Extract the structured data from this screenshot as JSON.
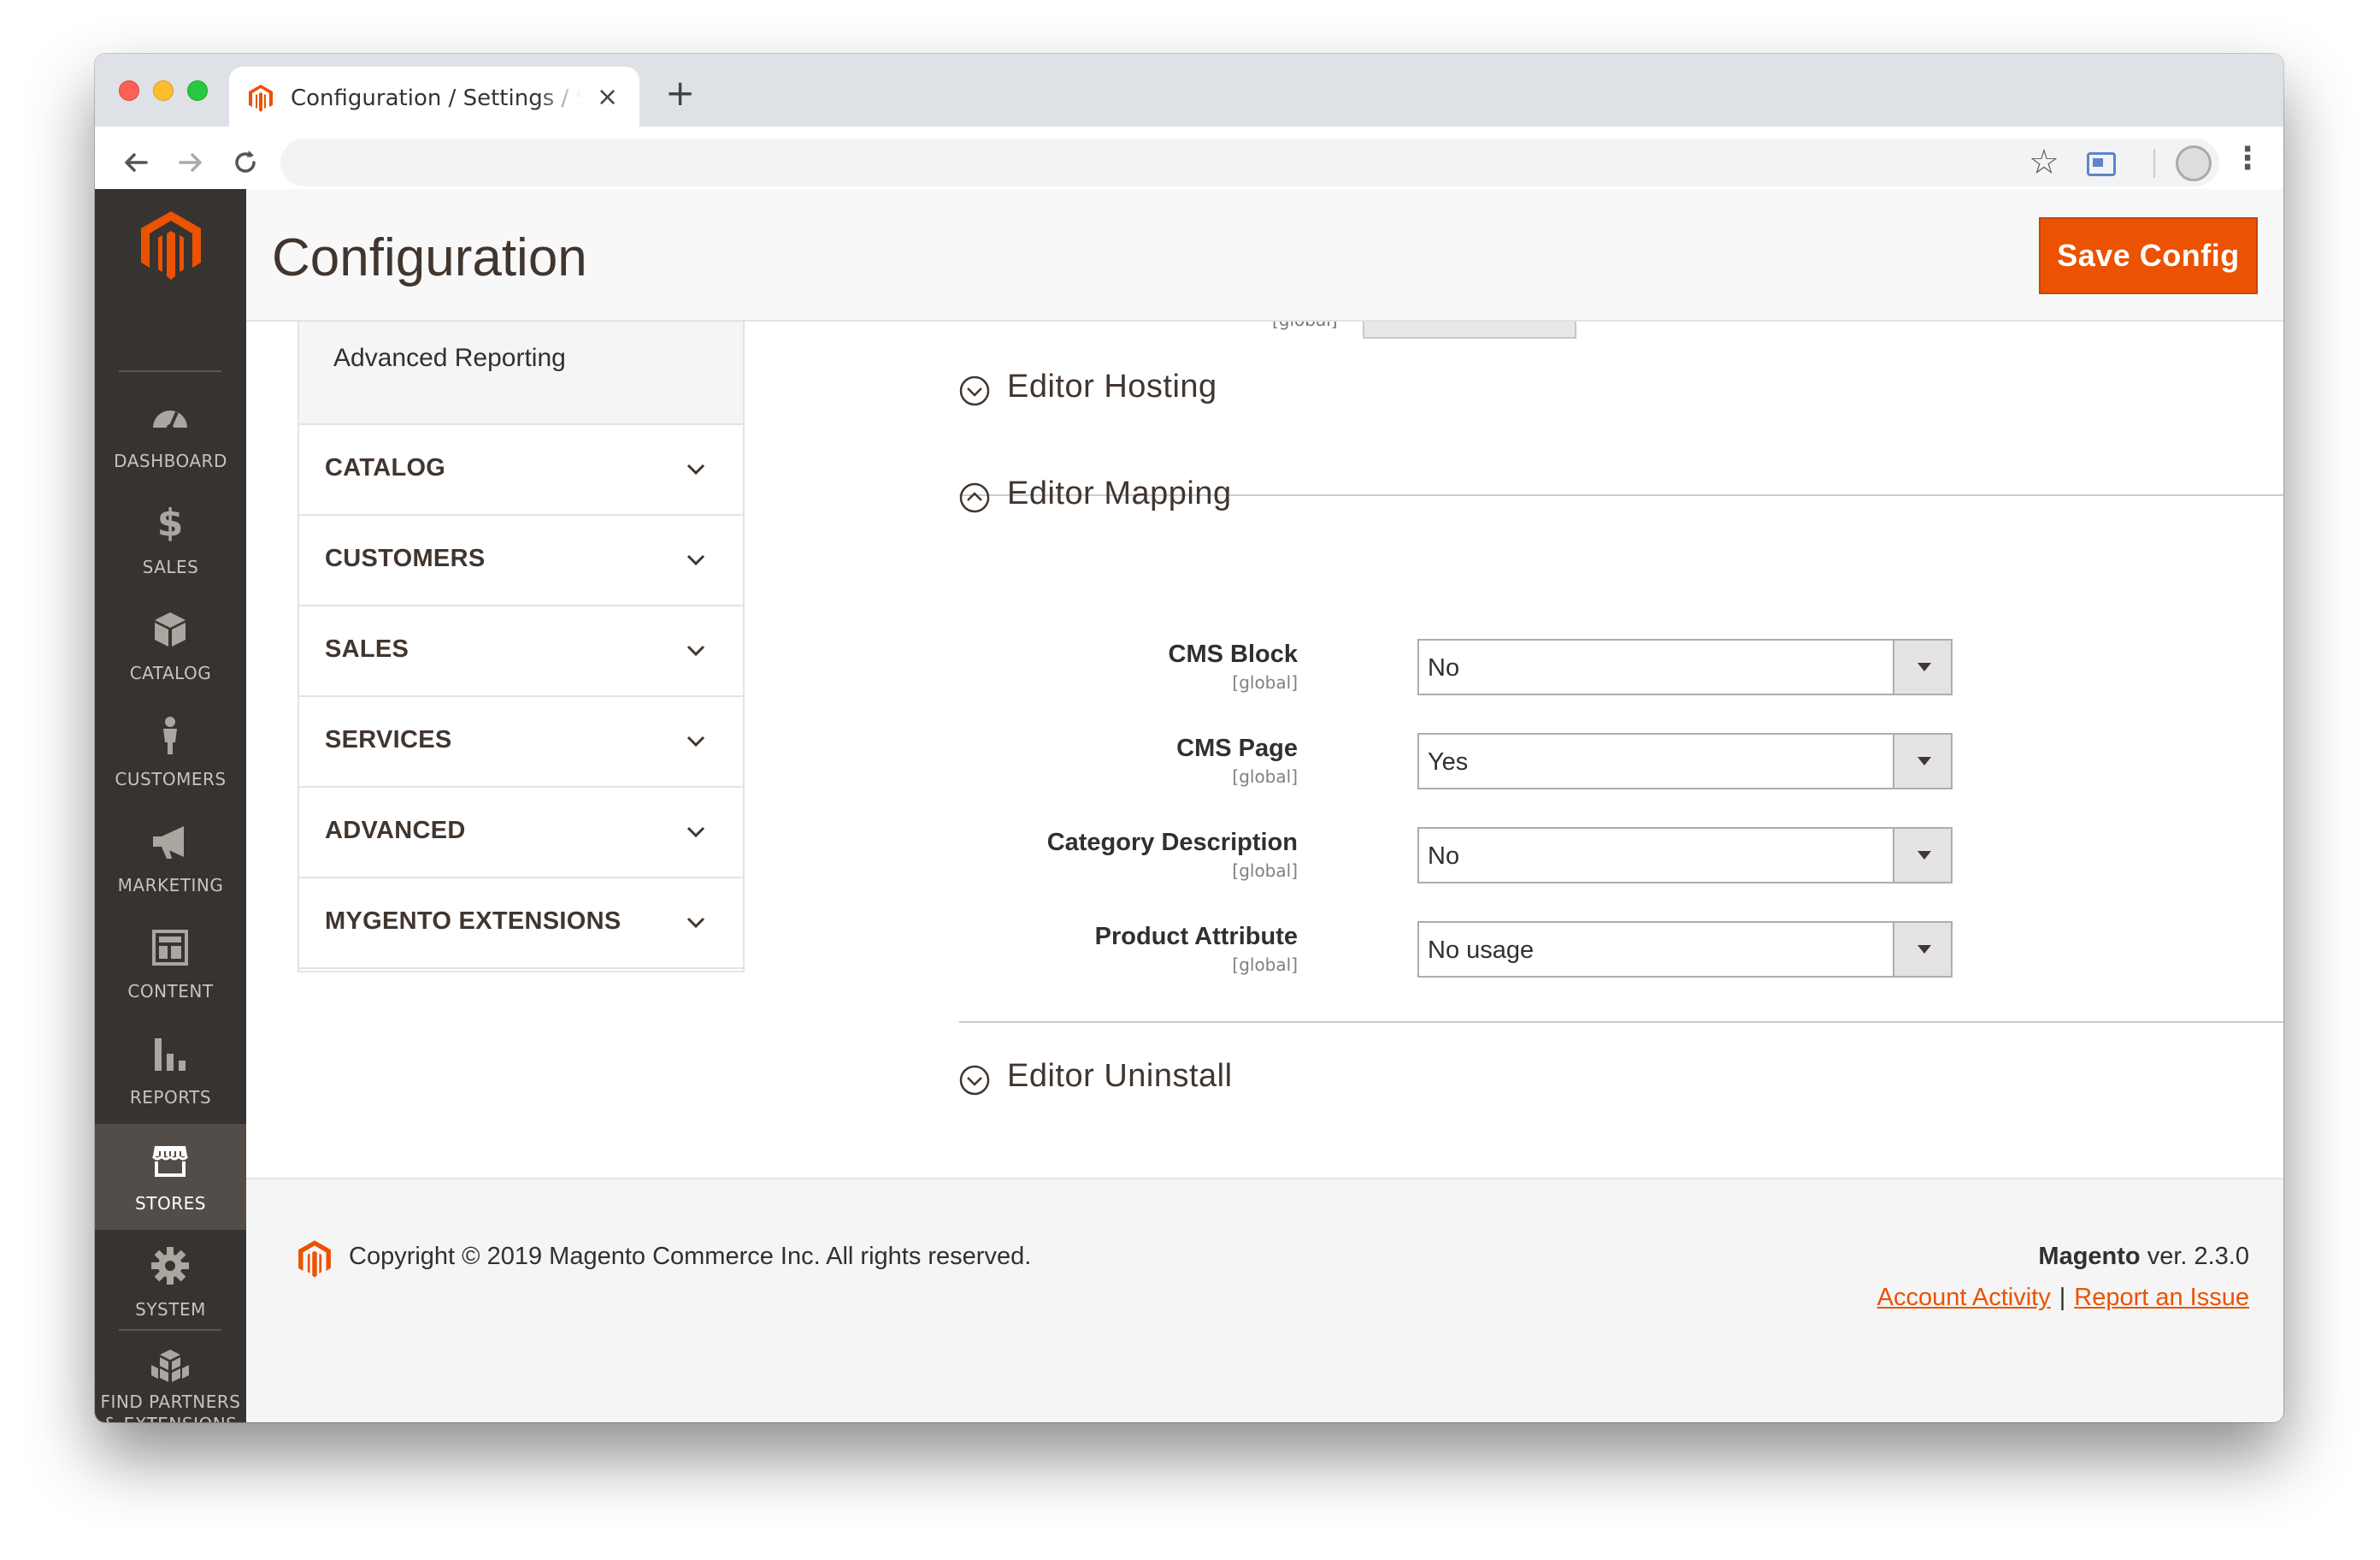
{
  "browser": {
    "tab_title": "Configuration / Settings / Stores / Magento Admin",
    "new_tab_symbol": "+",
    "close_symbol": "×",
    "url": ""
  },
  "admin_nav": [
    {
      "label": "DASHBOARD",
      "icon": "dashboard-icon",
      "active": false
    },
    {
      "label": "SALES",
      "icon": "dollar-icon",
      "active": false
    },
    {
      "label": "CATALOG",
      "icon": "box-icon",
      "active": false
    },
    {
      "label": "CUSTOMERS",
      "icon": "person-icon",
      "active": false
    },
    {
      "label": "MARKETING",
      "icon": "megaphone-icon",
      "active": false
    },
    {
      "label": "CONTENT",
      "icon": "layout-icon",
      "active": false
    },
    {
      "label": "REPORTS",
      "icon": "bar-chart-icon",
      "active": false
    },
    {
      "label": "STORES",
      "icon": "storefront-icon",
      "active": true
    },
    {
      "label": "SYSTEM",
      "icon": "gear-icon",
      "active": false
    },
    {
      "label": "FIND PARTNERS",
      "label2": "& EXTENSIONS",
      "icon": "cubes-icon",
      "active": false
    }
  ],
  "header": {
    "title": "Configuration",
    "save_label": "Save Config"
  },
  "config_tabs": {
    "sub_item": "Advanced Reporting",
    "sections": [
      "CATALOG",
      "CUSTOMERS",
      "SALES",
      "SERVICES",
      "ADVANCED",
      "MYGENTO EXTENSIONS"
    ]
  },
  "main": {
    "partial_row_scope": "[global]",
    "fieldsets": {
      "hosting": "Editor Hosting",
      "mapping": "Editor Mapping",
      "uninstall": "Editor Uninstall"
    },
    "fields": [
      {
        "label": "CMS Block",
        "scope": "[global]",
        "value": "No"
      },
      {
        "label": "CMS Page",
        "scope": "[global]",
        "value": "Yes"
      },
      {
        "label": "Category Description",
        "scope": "[global]",
        "value": "No"
      },
      {
        "label": "Product Attribute",
        "scope": "[global]",
        "value": "No usage"
      }
    ]
  },
  "footer": {
    "copyright": "Copyright © 2019 Magento Commerce Inc. All rights reserved.",
    "brand": "Magento",
    "version": " ver. 2.3.0",
    "link_account": "Account Activity",
    "separator": "|",
    "link_issue": "Report an Issue"
  },
  "colors": {
    "accent": "#eb5202",
    "sidebar_bg": "#373330",
    "sidebar_active": "#524d49"
  }
}
